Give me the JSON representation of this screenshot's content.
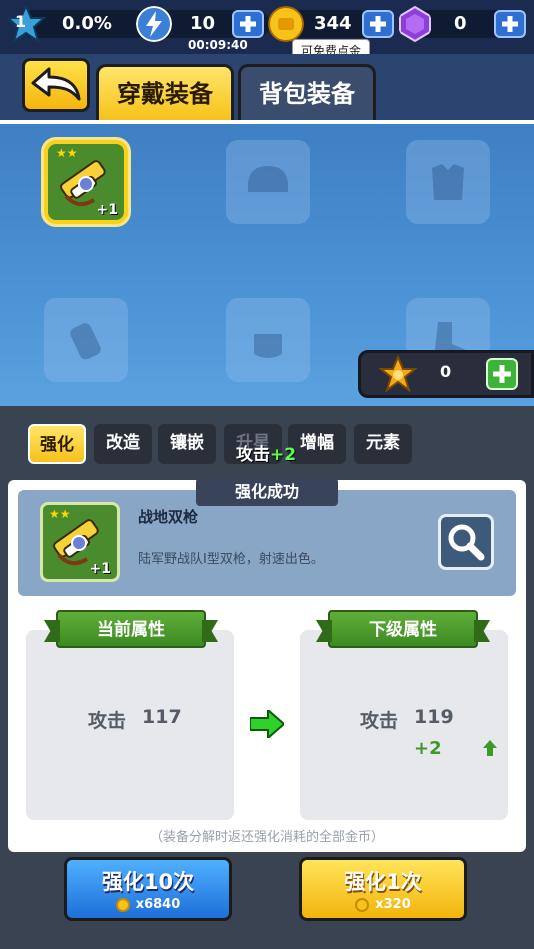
{
  "status_bar": {
    "level": "1",
    "exp_percent": "0.0%",
    "energy": "10",
    "energy_timer": "00:09:40",
    "gold": "344",
    "gold_tooltip": "可免费点金",
    "gems": "0"
  },
  "header": {
    "tabs": [
      "穿戴装备",
      "背包装备"
    ],
    "active_tab": 0
  },
  "equipment_grid": {
    "equipped_item_level": "+1",
    "star_counter": "0"
  },
  "upgrade_tabs": [
    "强化",
    "改造",
    "镶嵌",
    "升星",
    "增幅",
    "元素"
  ],
  "float_text": {
    "label": "攻击",
    "value": "+2"
  },
  "success_banner": "强化成功",
  "item": {
    "name": "战地双枪",
    "description": "陆军野战队Ⅰ型双枪，射速出色。",
    "level": "+1"
  },
  "current_attrs": {
    "title": "当前属性",
    "stat_name": "攻击",
    "stat_value": "117"
  },
  "next_attrs": {
    "title": "下级属性",
    "stat_name": "攻击",
    "stat_value": "119",
    "bonus": "+2"
  },
  "footnote": "（装备分解时返还强化消耗的全部金币）",
  "buttons": {
    "upgrade_10": {
      "label": "强化10次",
      "cost": "x6840"
    },
    "upgrade_1": {
      "label": "强化1次",
      "cost": "x320"
    }
  },
  "colors": {
    "accent_yellow": "#f6c21a",
    "panel_bg": "#3a4352",
    "success_green": "#3d9a28"
  }
}
